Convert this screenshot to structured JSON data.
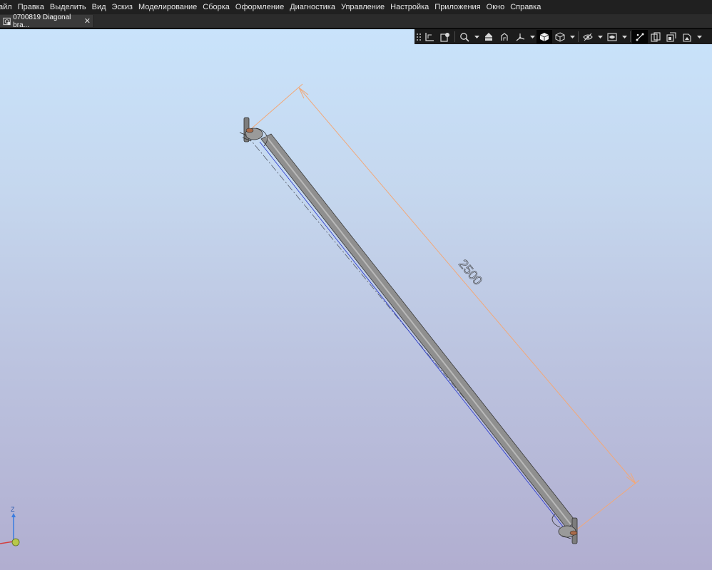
{
  "menu": {
    "items": [
      "айл",
      "Правка",
      "Выделить",
      "Вид",
      "Эскиз",
      "Моделирование",
      "Сборка",
      "Оформление",
      "Диагностика",
      "Управление",
      "Настройка",
      "Приложения",
      "Окно",
      "Справка"
    ]
  },
  "document_tab": {
    "title": "0700819 Diagonal bra...",
    "close_glyph": "✕"
  },
  "viewport": {
    "dimension_value": "2500",
    "axis_label": "Z"
  },
  "colors": {
    "menubar_bg": "#202020",
    "viewport_top": "#c9e3fb",
    "viewport_bottom": "#b1aed0",
    "dimension_line": "#f2a878",
    "model_edge": "#2233cc"
  },
  "toolbar_icons": [
    "grip-icon",
    "dimension-axis-icon",
    "view-orient-icon",
    "zoom-icon",
    "drop-arrow",
    "section-view-icon",
    "orient-cube-icon",
    "axes-icon",
    "drop-arrow",
    "shaded-cube-icon",
    "wireframe-cube-icon",
    "drop-arrow",
    "hide-eye-icon",
    "drop-arrow",
    "visibility-icon",
    "drop-arrow",
    "measure-icon",
    "views-icon",
    "layers-icon",
    "properties-icon",
    "drop-arrow"
  ]
}
